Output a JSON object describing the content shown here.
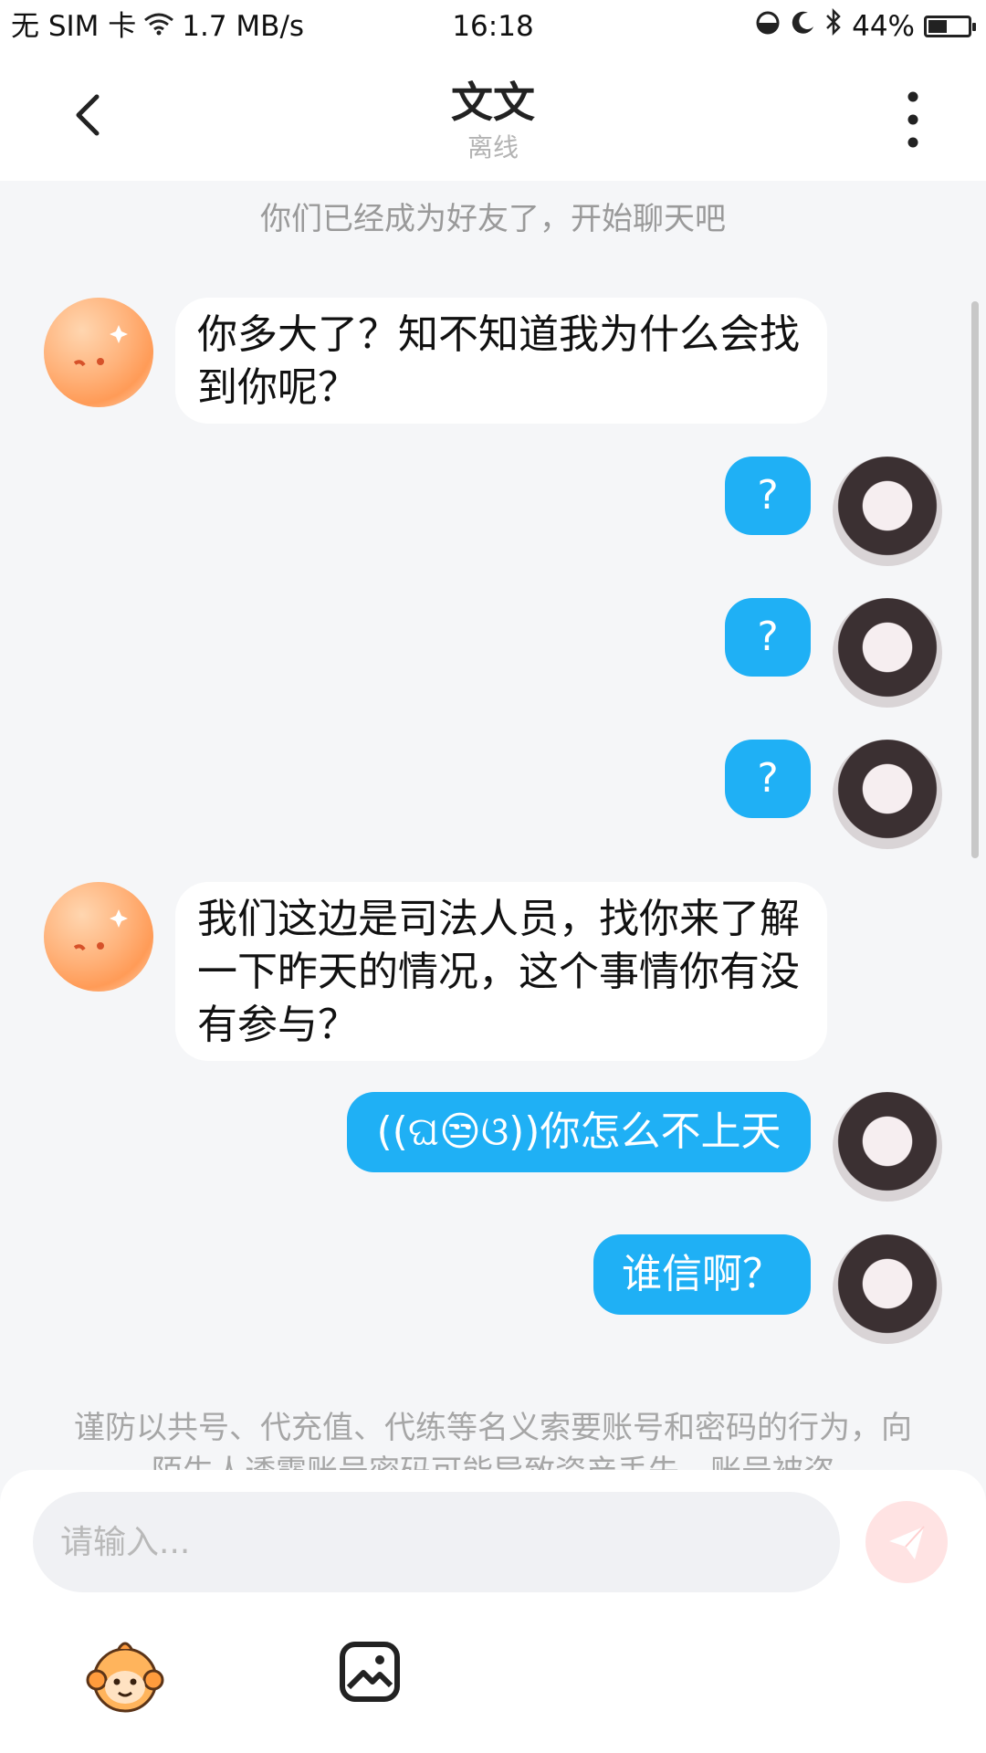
{
  "status_bar": {
    "carrier": "无 SIM 卡",
    "speed": "1.7 MB/s",
    "time": "16:18",
    "battery": "44%",
    "battery_level": 0.44
  },
  "header": {
    "title": "文文",
    "subtitle": "离线"
  },
  "system_tip": "你们已经成为好友了，开始聊天吧",
  "messages": [
    {
      "side": "in",
      "text": "你多大了？知不知道我为什么会找到你呢？"
    },
    {
      "side": "out",
      "text": "?"
    },
    {
      "side": "out",
      "text": "?"
    },
    {
      "side": "out",
      "text": "?"
    },
    {
      "side": "in",
      "text": "我们这边是司法人员，找你来了解一下昨天的情况，这个事情你有没有参与？"
    },
    {
      "side": "out",
      "text": "((ଘ😒ଓ))你怎么不上天"
    },
    {
      "side": "out",
      "text": "谁信啊？"
    }
  ],
  "warning": "谨防以共号、代充值、代练等名义索要账号和密码的行为，向陌生人透露账号密码可能导致资产丢失，账号被盗",
  "input": {
    "placeholder": "请输入..."
  },
  "colors": {
    "outgoing_bubble": "#1fb0f5",
    "incoming_bubble": "#ffffff",
    "send_button": "#ffe3e3"
  }
}
